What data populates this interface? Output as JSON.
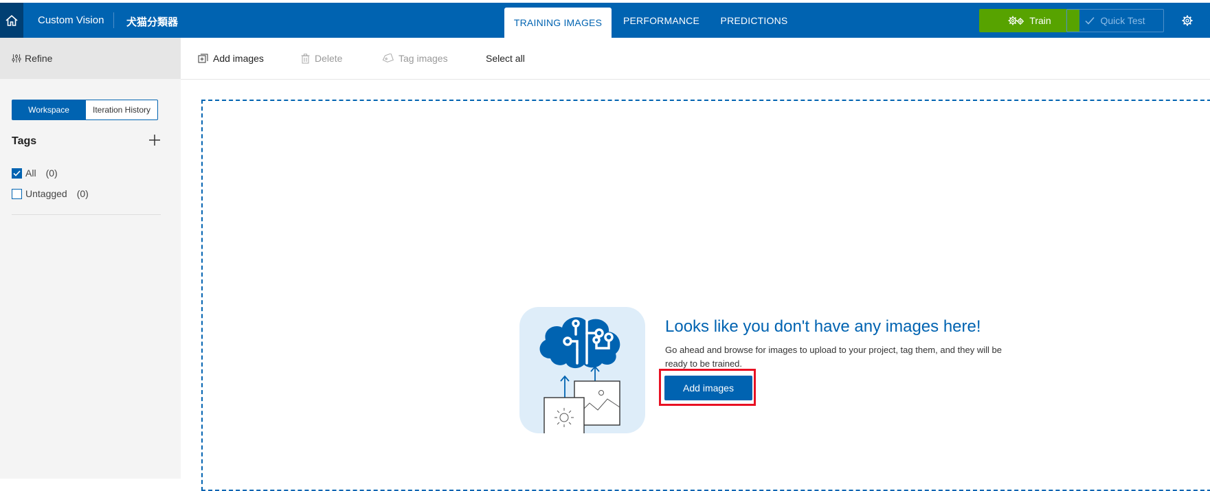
{
  "header": {
    "brand": "Custom Vision",
    "project_name": "犬猫分類器",
    "tabs": [
      {
        "label": "TRAINING IMAGES",
        "active": true
      },
      {
        "label": "PERFORMANCE",
        "active": false
      },
      {
        "label": "PREDICTIONS",
        "active": false
      }
    ],
    "train_label": "Train",
    "quick_test_label": "Quick Test"
  },
  "sidebar": {
    "refine_label": "Refine",
    "segments": [
      "Workspace",
      "Iteration History"
    ],
    "tags_title": "Tags",
    "tags": [
      {
        "label": "All",
        "count": "(0)",
        "checked": true
      },
      {
        "label": "Untagged",
        "count": "(0)",
        "checked": false
      }
    ]
  },
  "toolbar": {
    "add_images": "Add images",
    "delete": "Delete",
    "tag_images": "Tag images",
    "select_all": "Select all"
  },
  "empty_state": {
    "title": "Looks like you don't have any images here!",
    "description": "Go ahead and browse for images to upload to your project, tag them, and they will be ready to be trained.",
    "button_label": "Add images"
  },
  "colors": {
    "primary": "#0063b1",
    "train_green": "#57a300",
    "highlight_red": "#e81123"
  },
  "icons": {
    "home": "home-icon",
    "train": "gears-icon",
    "quick_test": "check-icon",
    "settings": "gear-icon",
    "refine": "sliders-icon",
    "add_tag": "plus-icon",
    "add_images": "add-images-icon",
    "delete": "trash-icon",
    "tag_images": "tag-icon"
  }
}
